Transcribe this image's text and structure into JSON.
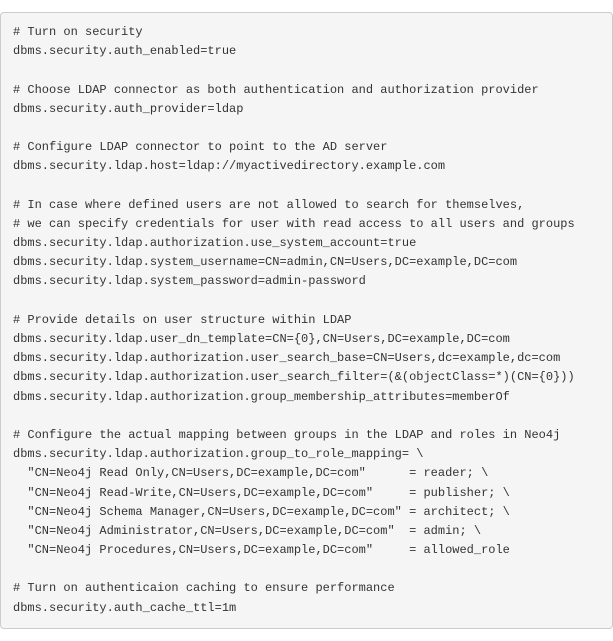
{
  "code": {
    "lines": [
      "# Turn on security",
      "dbms.security.auth_enabled=true",
      "",
      "# Choose LDAP connector as both authentication and authorization provider",
      "dbms.security.auth_provider=ldap",
      "",
      "# Configure LDAP connector to point to the AD server",
      "dbms.security.ldap.host=ldap://myactivedirectory.example.com",
      "",
      "# In case where defined users are not allowed to search for themselves,",
      "# we can specify credentials for user with read access to all users and groups",
      "dbms.security.ldap.authorization.use_system_account=true",
      "dbms.security.ldap.system_username=CN=admin,CN=Users,DC=example,DC=com",
      "dbms.security.ldap.system_password=admin-password",
      "",
      "# Provide details on user structure within LDAP",
      "dbms.security.ldap.user_dn_template=CN={0},CN=Users,DC=example,DC=com",
      "dbms.security.ldap.authorization.user_search_base=CN=Users,dc=example,dc=com",
      "dbms.security.ldap.authorization.user_search_filter=(&(objectClass=*)(CN={0}))",
      "dbms.security.ldap.authorization.group_membership_attributes=memberOf",
      "",
      "# Configure the actual mapping between groups in the LDAP and roles in Neo4j",
      "dbms.security.ldap.authorization.group_to_role_mapping= \\",
      "  \"CN=Neo4j Read Only,CN=Users,DC=example,DC=com\"      = reader; \\",
      "  \"CN=Neo4j Read-Write,CN=Users,DC=example,DC=com\"     = publisher; \\",
      "  \"CN=Neo4j Schema Manager,CN=Users,DC=example,DC=com\" = architect; \\",
      "  \"CN=Neo4j Administrator,CN=Users,DC=example,DC=com\"  = admin; \\",
      "  \"CN=Neo4j Procedures,CN=Users,DC=example,DC=com\"     = allowed_role",
      "",
      "# Turn on authenticaion caching to ensure performance",
      "dbms.security.auth_cache_ttl=1m"
    ]
  }
}
